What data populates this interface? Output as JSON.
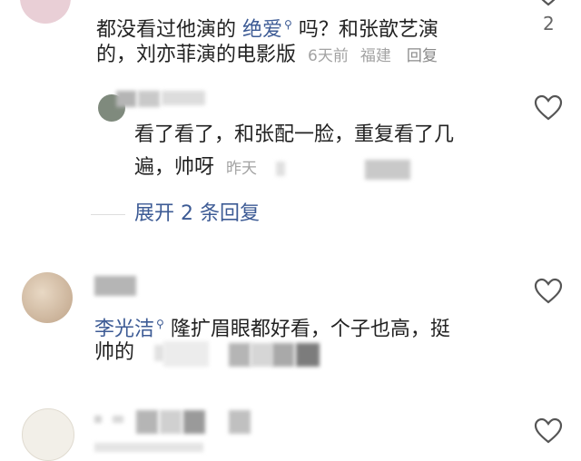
{
  "comment1": {
    "line1_pre": "都没看过他演的",
    "line1_link": "绝爱",
    "line1_post": "吗？和张歆艺演",
    "line2_text": "的，刘亦菲演的电影版",
    "time": "6天前",
    "location": "福建",
    "reply_label": "回复",
    "like_count": "2"
  },
  "reply1": {
    "line1": "看了看了，和张配一脸，重复看了几",
    "line2": "遍，帅呀",
    "time": "昨天"
  },
  "expand": {
    "label": "展开 2 条回复"
  },
  "comment2": {
    "link": "李光洁",
    "line1_post": "隆扩眉眼都好看，个子也高，挺",
    "line2": "帅的"
  },
  "icons": {
    "heart": "heart-outline-icon",
    "search_hint": "search-hint-icon",
    "heart_color": "#555555",
    "link_color": "#3d5b95"
  }
}
